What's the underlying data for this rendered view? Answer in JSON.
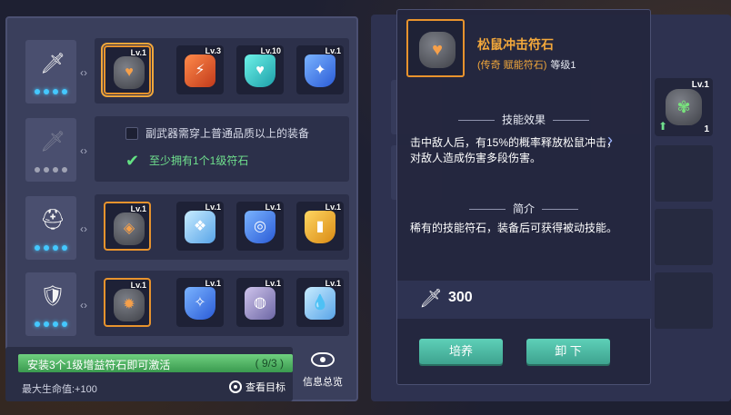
{
  "slots": [
    {
      "icon": "sword-icon",
      "glyph": "🗡",
      "dots": 4,
      "dots_on": 4,
      "locked": false
    },
    {
      "icon": "sword-icon",
      "glyph": "🗡",
      "dots": 4,
      "dots_on": 0,
      "locked": true
    },
    {
      "icon": "helmet-icon",
      "glyph": "⛑",
      "dots": 4,
      "dots_on": 4,
      "locked": false
    },
    {
      "icon": "armor-icon",
      "glyph": "🛡",
      "dots": 4,
      "dots_on": 4,
      "locked": false
    }
  ],
  "rows": [
    {
      "runes": [
        {
          "level": "Lv.1",
          "color": "stone",
          "symbol": "♥",
          "selected": true
        },
        {
          "level": "Lv.3",
          "color": "red",
          "symbol": "⚡"
        },
        {
          "level": "Lv.10",
          "color": "teal",
          "symbol": "♥"
        },
        {
          "level": "Lv.1",
          "color": "blue",
          "symbol": "✦"
        }
      ]
    },
    {
      "conditions": [
        {
          "text": "副武器需穿上普通品质以上的装备",
          "met": false
        },
        {
          "text": "至少拥有1个1级符石",
          "met": true
        }
      ]
    },
    {
      "runes": [
        {
          "level": "Lv.1",
          "color": "stone",
          "symbol": "◈",
          "gold": true
        },
        {
          "level": "Lv.1",
          "color": "ice",
          "symbol": "❖"
        },
        {
          "level": "Lv.1",
          "color": "blue",
          "symbol": "◎"
        },
        {
          "level": "Lv.1",
          "color": "gold",
          "symbol": "▮"
        }
      ]
    },
    {
      "runes": [
        {
          "level": "Lv.1",
          "color": "stone",
          "symbol": "✹",
          "gold": true
        },
        {
          "level": "Lv.1",
          "color": "blue",
          "symbol": "✧"
        },
        {
          "level": "Lv.1",
          "color": "purple",
          "symbol": "◍"
        },
        {
          "level": "Lv.1",
          "color": "ice",
          "symbol": "💧"
        }
      ]
    }
  ],
  "bonus": {
    "progress_text": "安装3个1级增益符石即可激活",
    "progress_count": "( 9/3 )",
    "progress_fraction": 1.0,
    "hp_text": "最大生命值:+100",
    "view_target_label": "查看目标",
    "info_overview_label": "信息总览"
  },
  "card": {
    "title": "松鼠冲击符石",
    "rarity": "(传奇 赋能符石)",
    "level": "等级1",
    "skill_header": "技能效果",
    "skill_text": "击中敌人后，有15%的概率释放松鼠冲击，对敌人造成伤害多段伤害。",
    "intro_header": "简介",
    "intro_text": "稀有的技能符石，装备后可获得被动技能。",
    "power": "300",
    "cultivate_label": "培养",
    "unequip_label": "卸 下"
  },
  "side_rune": {
    "level": "Lv.1",
    "count": "1"
  },
  "colors": {
    "accent": "#f3a83b",
    "button": "#4fbfa7",
    "progress": "#5ec46f"
  }
}
